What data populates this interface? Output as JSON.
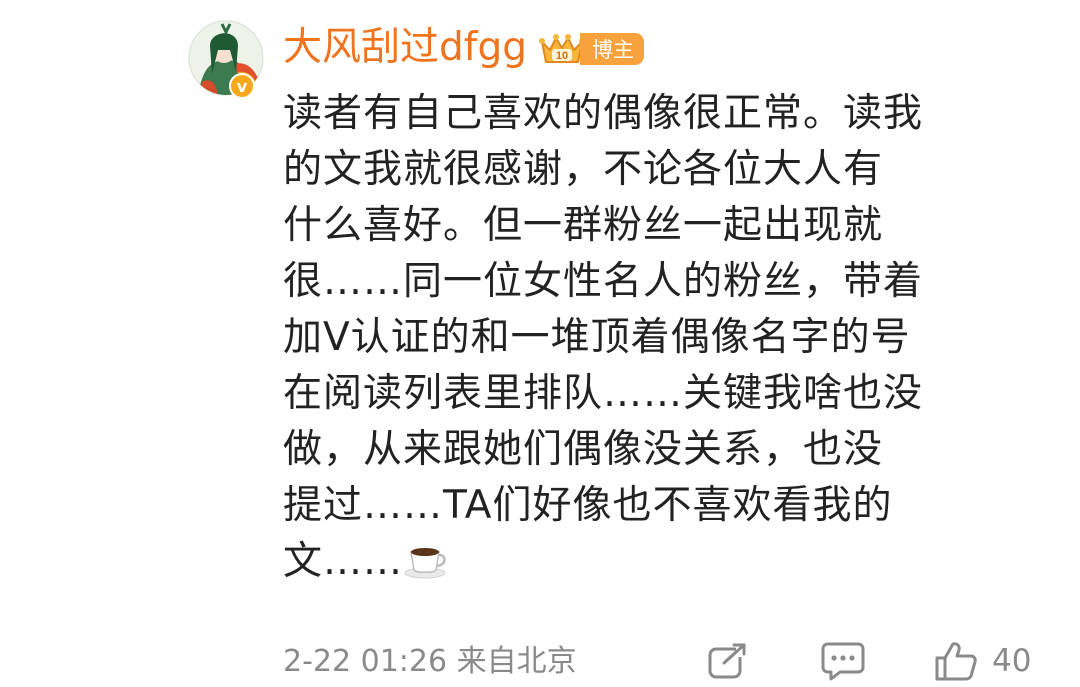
{
  "post": {
    "username": "大风刮过dfgg",
    "badge_label": "博主",
    "crown_icon": "crown-10-icon",
    "verified_mark": "v",
    "comment_lines": [
      "读者有自己喜欢的偶像很正常。读我",
      "的文我就很感谢，不论各位大人有",
      "什么喜好。但一群粉丝一起出现就",
      "很……同一位女性名人的粉丝，带着",
      "加V认证的和一堆顶着偶像名字的号",
      "在阅读列表里排队……关键我啥也没",
      "做，从来跟她们偶像没关系，也没",
      "提过……TA们好像也不喜欢看我的",
      "文……"
    ],
    "comment_end_emoji": "coffee-cup-icon",
    "timestamp": "2-22 01:26",
    "source": "来自北京",
    "actions": {
      "share_icon": "share-icon",
      "comment_icon": "comment-icon",
      "like_icon": "thumbs-up-icon",
      "like_count": "40"
    },
    "colors": {
      "username": "#f0741e",
      "badge": "#f7a23c",
      "verified": "#f6a81b",
      "meta": "#8a8a8a"
    }
  }
}
